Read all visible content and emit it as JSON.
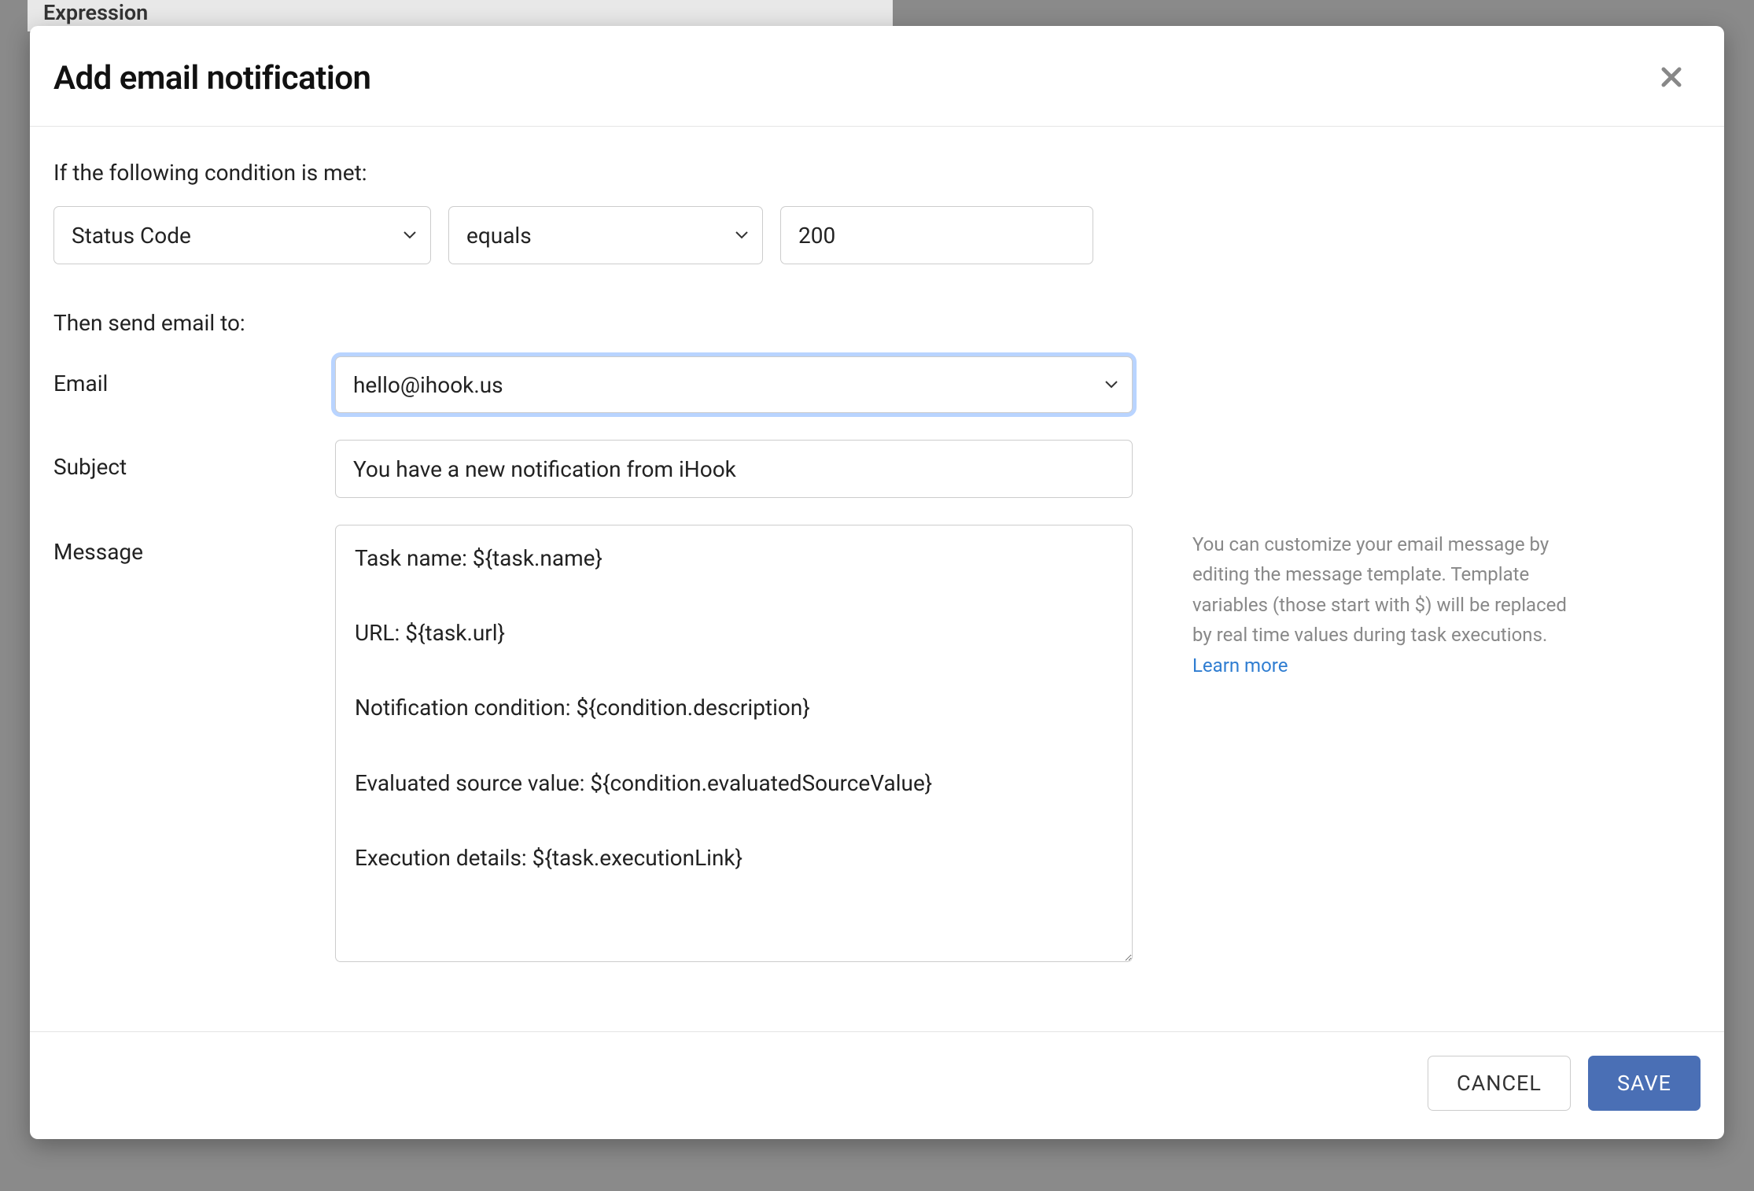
{
  "background": {
    "expression_label": "Expression"
  },
  "modal": {
    "title": "Add email notification",
    "condition": {
      "label": "If the following condition is met:",
      "field_options": [
        "Status Code"
      ],
      "field_value": "Status Code",
      "operator_options": [
        "equals"
      ],
      "operator_value": "equals",
      "value": "200"
    },
    "then_label": "Then send email to:",
    "email": {
      "label": "Email",
      "options": [
        "hello@ihook.us"
      ],
      "value": "hello@ihook.us"
    },
    "subject": {
      "label": "Subject",
      "value": "You have a new notification from iHook"
    },
    "message": {
      "label": "Message",
      "value": "Task name: ${task.name}\n\nURL: ${task.url}\n\nNotification condition: ${condition.description}\n\nEvaluated source value: ${condition.evaluatedSourceValue}\n\nExecution details: ${task.executionLink}"
    },
    "help": {
      "text": "You can customize your email message by editing the message template. Template variables (those start with $) will be replaced by real time values during task executions. ",
      "link_text": "Learn more"
    },
    "footer": {
      "cancel": "CANCEL",
      "save": "SAVE"
    }
  }
}
